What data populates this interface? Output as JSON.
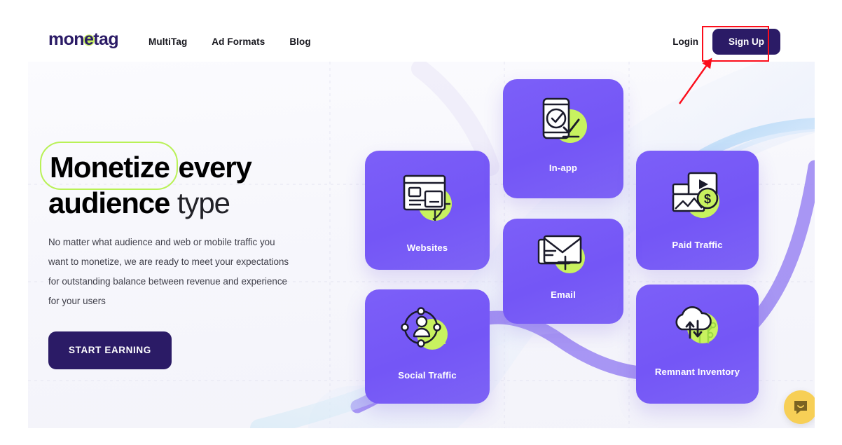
{
  "header": {
    "logo": {
      "text_before": "mon",
      "text_e": "e",
      "text_after": "tag",
      "full": "monetag"
    },
    "nav": [
      {
        "label": "MultiTag",
        "name": "nav-multitag"
      },
      {
        "label": "Ad Formats",
        "name": "nav-ad-formats"
      },
      {
        "label": "Blog",
        "name": "nav-blog"
      }
    ],
    "login_label": "Login",
    "signup_label": "Sign Up"
  },
  "hero": {
    "title_highlight": "Monetize",
    "title_bold_rest": " every",
    "title_line2_bold": "audience",
    "title_line2_light": " type",
    "subtitle": "No matter what audience and web or mobile traffic you want to monetize, we are ready to meet your expectations for outstanding balance between revenue and experience for your users",
    "cta_label": "START EARNING"
  },
  "cards": [
    {
      "label": "Websites",
      "icon": "browser-globe-icon",
      "name": "card-websites"
    },
    {
      "label": "In-app",
      "icon": "mobile-check-icon",
      "name": "card-inapp"
    },
    {
      "label": "Paid Traffic",
      "icon": "video-dollar-icon",
      "name": "card-paid-traffic"
    },
    {
      "label": "Email",
      "icon": "envelope-icon",
      "name": "card-email"
    },
    {
      "label": "Social Traffic",
      "icon": "social-network-icon",
      "name": "card-social-traffic"
    },
    {
      "label": "Remnant Inventory",
      "icon": "cloud-transfer-icon",
      "name": "card-remnant-inventory"
    }
  ],
  "widgets": {
    "chat_icon": "chat-bubble-smile-icon"
  },
  "annotation": {
    "target": "Sign Up",
    "box_color": "#fc0d1b",
    "arrow_color": "#fc0d1b"
  },
  "colors": {
    "brand_dark": "#2b1b66",
    "card_purple": "#7558f6",
    "accent_green": "#c8f25f",
    "chat_yellow": "#f7cf56",
    "text_dark": "#16161d",
    "text_body": "#3d3d48"
  }
}
